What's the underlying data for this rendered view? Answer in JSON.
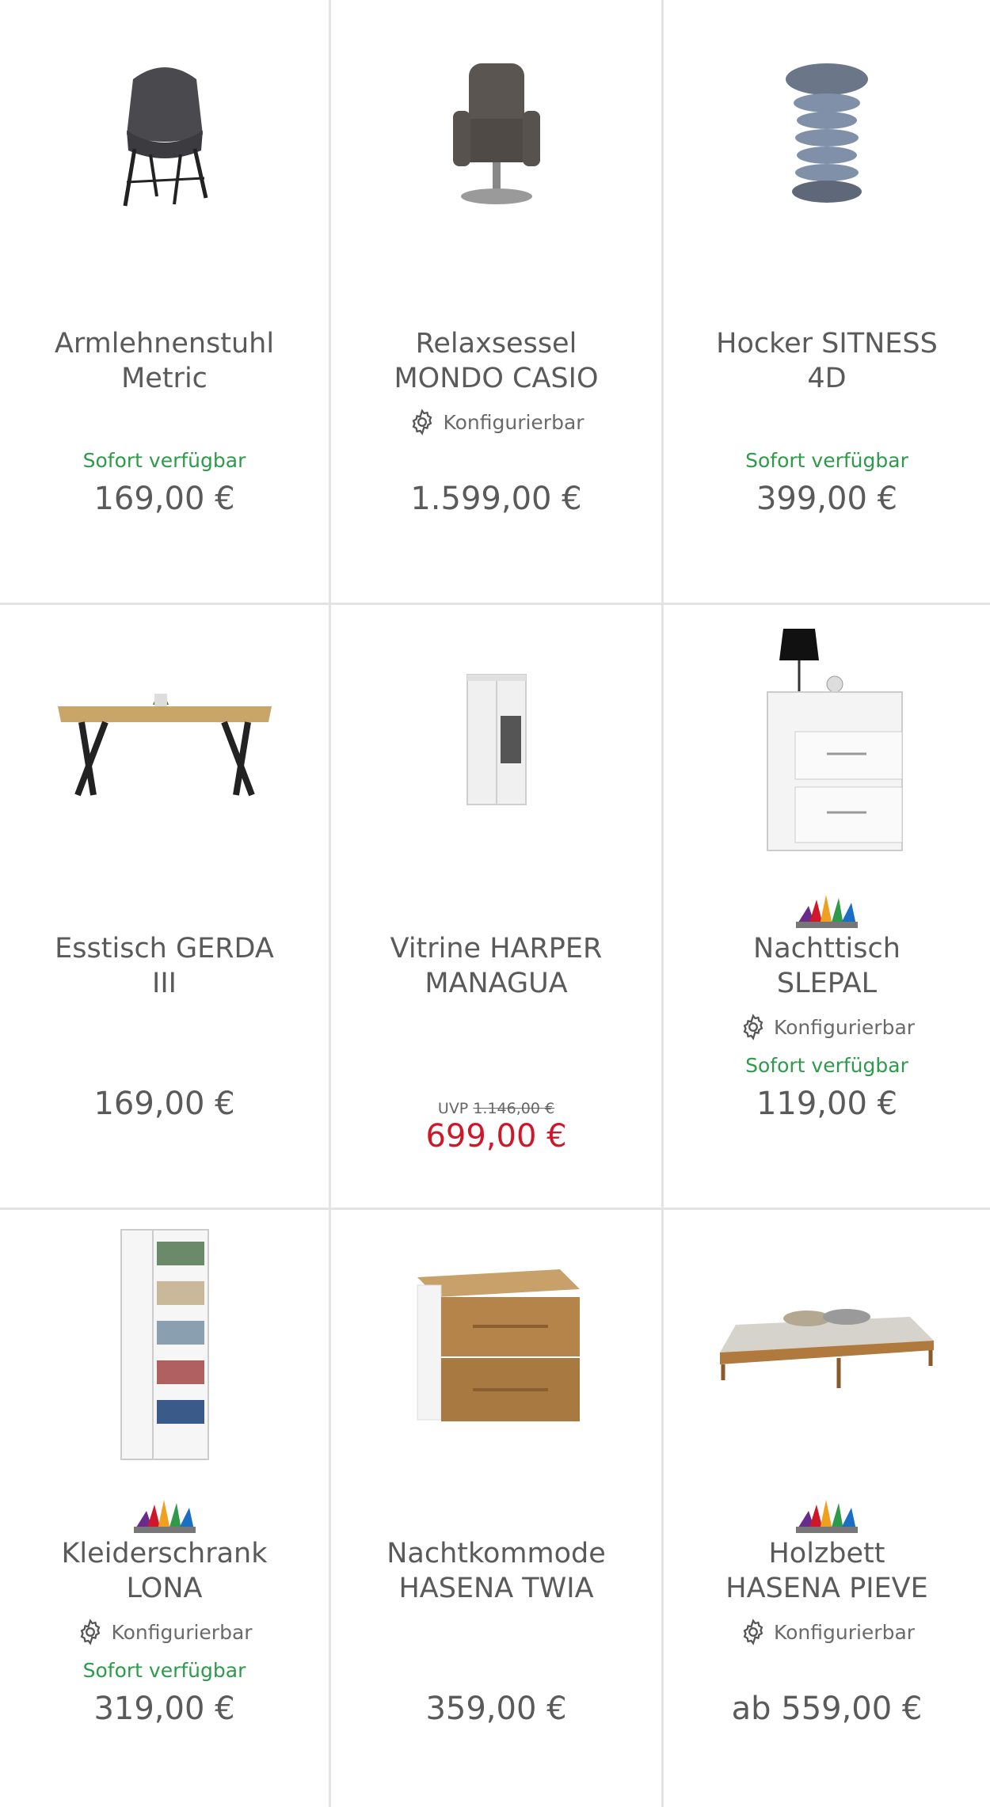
{
  "products": [
    {
      "title": "Armlehnenstuhl\nMetric",
      "config": "",
      "availability": "Sofort verfügbar",
      "price": "169,00 €",
      "image": "armchair-image"
    },
    {
      "title": "Relaxsessel\nMONDO CASIO",
      "config": "Konfigurierbar",
      "availability": "",
      "price": "1.599,00 €",
      "image": "recliner-image"
    },
    {
      "title": "Hocker SITNESS\n4D",
      "config": "",
      "availability": "Sofort verfügbar",
      "price": "399,00 €",
      "image": "stool-image"
    },
    {
      "title": "Esstisch GERDA\nIII",
      "config": "",
      "availability": "",
      "price": "169,00 €",
      "image": "dining-table-image"
    },
    {
      "title": "Vitrine HARPER\nMANAGUA",
      "config": "",
      "availability": "",
      "uvp_label": "UVP",
      "uvp_price": "1.146,00 €",
      "price": "699,00 €",
      "image": "vitrine-image"
    },
    {
      "title": "Nachttisch\nSLEPAL",
      "config": "Konfigurierbar",
      "availability": "Sofort verfügbar",
      "price": "119,00 €",
      "image": "nightstand-image"
    },
    {
      "title": "Kleiderschrank\nLONA",
      "config": "Konfigurierbar",
      "availability": "Sofort verfügbar",
      "price": "319,00 €",
      "image": "wardrobe-image"
    },
    {
      "title": "Nachtkommode\nHASENA TWIA",
      "config": "",
      "availability": "",
      "price": "359,00 €",
      "image": "night-cabinet-image"
    },
    {
      "title": "Holzbett\nHASENA PIEVE",
      "config": "Konfigurierbar",
      "availability": "",
      "price": "ab 559,00 €",
      "image": "bed-image"
    }
  ],
  "colors": {
    "available": "#2e9a4a",
    "sale": "#d0172a",
    "text": "#5a5a5a",
    "divider": "#e3e3e3"
  }
}
